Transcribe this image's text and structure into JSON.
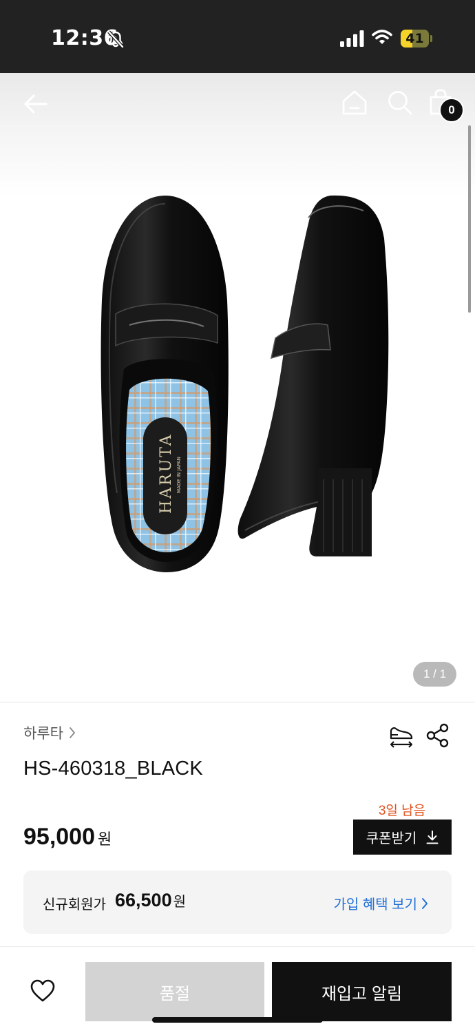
{
  "status_bar": {
    "time": "12:36",
    "battery_level": "41",
    "battery_fraction": 0.41,
    "icons": [
      "bell-slash-icon",
      "cellular-signal-icon",
      "wifi-icon",
      "battery-icon"
    ]
  },
  "header": {
    "icons": [
      "back-arrow-icon",
      "home-icon",
      "search-icon",
      "shopping-bag-icon"
    ],
    "cart_count": "0"
  },
  "gallery": {
    "image_counter": "1 / 1",
    "image_brand_text": "HARUTA",
    "image_subtext": "MADE IN JAPAN"
  },
  "product": {
    "brand": "하루타",
    "title": "HS-460318_BLACK",
    "price": "95,000",
    "price_unit": "원",
    "coupon_days_left": "3일 남음",
    "coupon_button": "쿠폰받기",
    "icons": [
      "chevron-right-icon",
      "size-guide-icon",
      "share-icon",
      "download-icon"
    ]
  },
  "member_offer": {
    "label": "신규회원가",
    "price": "66,500",
    "price_unit": "원",
    "link": "가입 혜택 보기"
  },
  "bottom_bar": {
    "wish_icon": "heart-icon",
    "soldout_label": "품절",
    "restock_label": "재입고 알림"
  },
  "colors": {
    "status_bar_bg": "#222222",
    "primary_black": "#111111",
    "accent_orange": "#e0531f",
    "link_blue": "#1f6fd6",
    "soldout_gray": "#d3d3d3",
    "battery_yellow": "#f5d328"
  }
}
